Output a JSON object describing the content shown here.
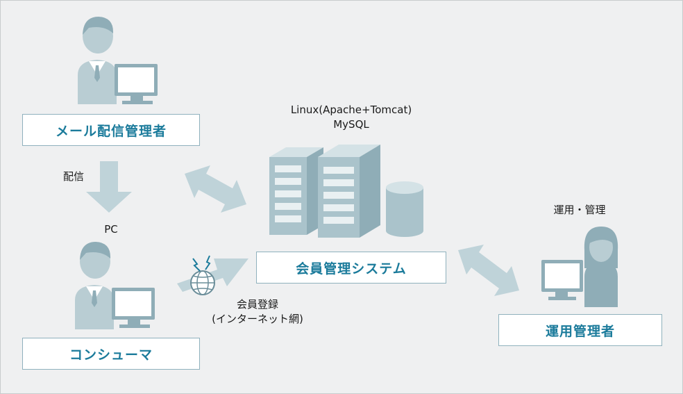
{
  "nodes": {
    "mail_admin": "メール配信管理者",
    "member_system": "会員管理システム",
    "consumer": "コンシューマ",
    "ops_admin": "運用管理者"
  },
  "labels": {
    "server_line1": "Linux(Apache+Tomcat)",
    "server_line2": "MySQL",
    "delivery": "配信",
    "pc": "PC",
    "ops": "運用・管理",
    "registration_line1": "会員登録",
    "registration_line2": "(インターネット網)"
  },
  "colors": {
    "background": "#eff0f1",
    "accent_text": "#1b7b9b",
    "box_border": "#8fb1bd",
    "arrow": "#bfd3d9",
    "figure": "#b9cdd3",
    "figure_dark": "#8fadb7",
    "server": "#aac3cb"
  },
  "icons": [
    "person-pc-icon",
    "server-icon",
    "database-icon",
    "globe-icon",
    "signal-icon",
    "woman-pc-icon"
  ]
}
